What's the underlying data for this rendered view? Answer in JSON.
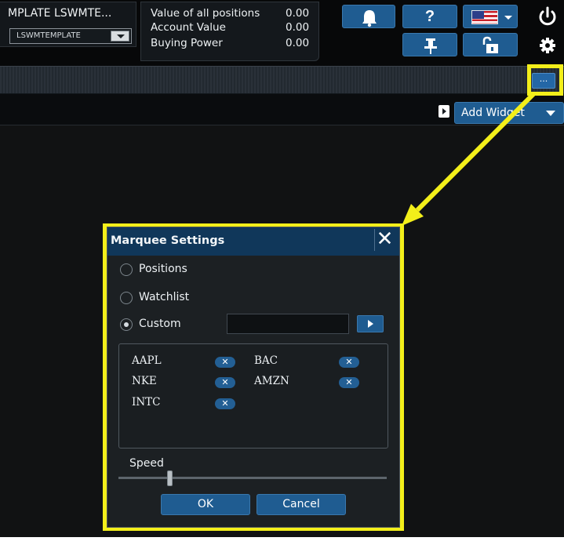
{
  "header": {
    "account_name": "MPLATE LSWMTE...",
    "account_select_value": "LSWMTEMPLATE",
    "values": [
      {
        "label": "Value of all positions",
        "value": "0.00"
      },
      {
        "label": "Account Value",
        "value": "0.00"
      },
      {
        "label": "Buying Power",
        "value": "0.00"
      }
    ],
    "help_label": "?"
  },
  "marquee": {
    "settings_button_label": "..."
  },
  "widget_bar": {
    "add_widget_label": "Add Widget"
  },
  "dialog": {
    "title": "Marquee Settings",
    "close_label": "✕",
    "radio_options": [
      "Positions",
      "Watchlist",
      "Custom"
    ],
    "selected_option": "Custom",
    "custom_input_value": "",
    "symbols": [
      {
        "symbol": "AAPL",
        "remove_label": "✕"
      },
      {
        "symbol": "BAC",
        "remove_label": "✕"
      },
      {
        "symbol": "NKE",
        "remove_label": "✕"
      },
      {
        "symbol": "AMZN",
        "remove_label": "✕"
      },
      {
        "symbol": "INTC",
        "remove_label": "✕"
      }
    ],
    "speed_label": "Speed",
    "speed_value_fraction": 0.19,
    "ok_label": "OK",
    "cancel_label": "Cancel"
  },
  "colors": {
    "accent_blue": "#1f5c91",
    "highlight_yellow": "#f3ef1a",
    "background_dark": "#111213"
  }
}
